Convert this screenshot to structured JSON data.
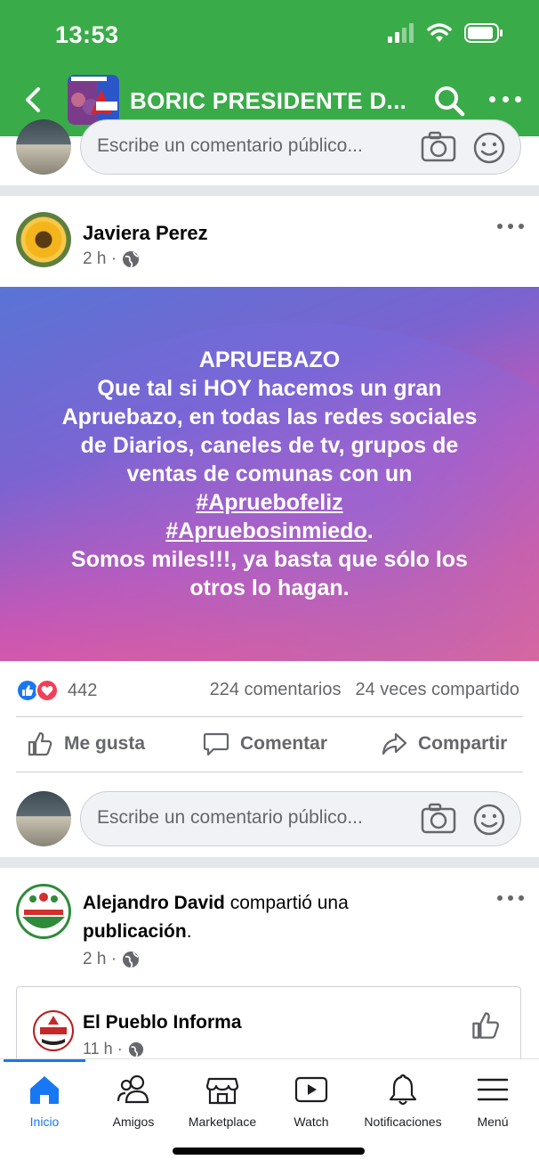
{
  "status_bar": {
    "time": "13:53"
  },
  "header": {
    "title": "BORIC PRESIDENTE D...",
    "colors": {
      "bar": "#3aab49"
    },
    "icons": [
      "back-arrow-icon",
      "search-icon",
      "more-options-icon"
    ]
  },
  "top_comment": {
    "placeholder": "Escribe un comentario público..."
  },
  "post": {
    "author": "Javiera Perez",
    "time": "2 h ·",
    "text_lines": [
      "APRUEBAZO",
      "Que tal si HOY hacemos un gran",
      "Apruebazo, en todas las redes sociales",
      "de Diarios, caneles de tv, grupos de",
      "ventas de comunas con un"
    ],
    "hashtag1": "#Apruebofeliz",
    "hashtag2": "#Apruebosinmiedo",
    "hashtag2_suffix": ".",
    "closing_lines": [
      "Somos miles!!!, ya basta que sólo los",
      "otros lo hagan."
    ],
    "reaction_count": "442",
    "comment_count": "224 comentarios",
    "share_count": "24 veces compartido",
    "actions": {
      "like": "Me gusta",
      "comment": "Comentar",
      "share": "Compartir"
    }
  },
  "post_comment": {
    "placeholder": "Escribe un comentario público..."
  },
  "shared_post": {
    "author": "Alejandro David",
    "action_text": " compartió una",
    "action_text_2": "publicación",
    "action_text_2_suffix": ".",
    "time": "2 h ·",
    "original": {
      "name": "El Pueblo Informa",
      "time": "11 h ·"
    }
  },
  "tabbar": {
    "tabs": [
      {
        "label": "Inicio",
        "icon": "home-icon"
      },
      {
        "label": "Amigos",
        "icon": "friends-icon"
      },
      {
        "label": "Marketplace",
        "icon": "marketplace-icon"
      },
      {
        "label": "Watch",
        "icon": "watch-icon"
      },
      {
        "label": "Notificaciones",
        "icon": "bell-icon"
      },
      {
        "label": "Menú",
        "icon": "menu-icon"
      }
    ]
  }
}
